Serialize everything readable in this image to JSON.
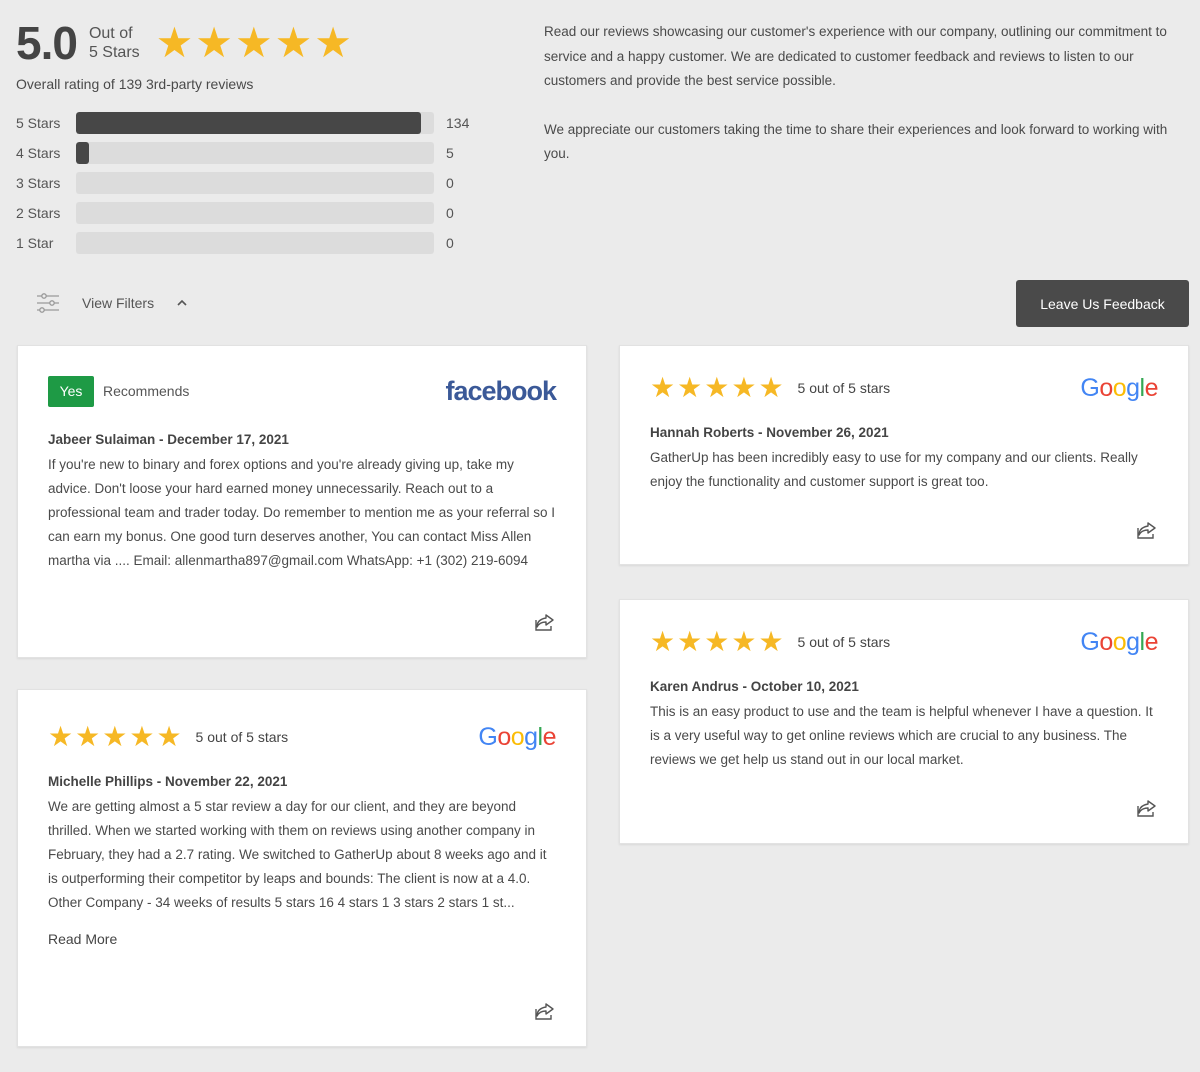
{
  "summary": {
    "rating": "5.0",
    "out_of_line1": "Out of",
    "out_of_line2": "5 Stars",
    "overall_text": "Overall rating of 139 3rd-party reviews",
    "distribution": [
      {
        "label": "5 Stars",
        "count": "134",
        "fraction": 0.964
      },
      {
        "label": "4 Stars",
        "count": "5",
        "fraction": 0.036
      },
      {
        "label": "3 Stars",
        "count": "0",
        "fraction": 0
      },
      {
        "label": "2 Stars",
        "count": "0",
        "fraction": 0
      },
      {
        "label": "1 Star",
        "count": "0",
        "fraction": 0
      }
    ]
  },
  "intro": {
    "p1": "Read our reviews showcasing our customer's experience with our company, outlining our commitment to service and a happy customer. We are dedicated to customer feedback and reviews to listen to our customers and provide the best service possible.",
    "p2": "We appreciate our customers taking the time to share their experiences and look forward to working with you."
  },
  "filters": {
    "label": "View Filters",
    "icon": "sliders-icon"
  },
  "feedback_button": "Leave Us Feedback",
  "reviews": [
    {
      "source": "facebook",
      "badge": "Yes",
      "recommends": "Recommends",
      "author": "Jabeer Sulaiman - December 17, 2021",
      "text": "If you're new to binary and forex options and you're already giving up, take my advice. Don't loose your hard earned money unnecessarily. Reach out to a professional team and trader today. Do remember to mention me as your referral so I can earn my bonus. One good turn deserves another, You can contact Miss Allen martha via .... Email: allenmartha897@gmail.com WhatsApp: +1 (302) 219-6094"
    },
    {
      "source": "Google",
      "stars_text": "5 out of 5 stars",
      "author": "Michelle Phillips - November 22, 2021",
      "text": "We are getting almost a 5 star review a day for our client, and they are beyond thrilled. When we started working with them on reviews using another company in February, they had a 2.7 rating. We switched to GatherUp about 8 weeks ago and it is outperforming their competitor by leaps and bounds: The client is now at a 4.0. Other Company - 34 weeks of results 5 stars 16 4 stars 1 3 stars 2 stars 1 st...",
      "read_more": "Read More"
    },
    {
      "source": "Google",
      "stars_text": "5 out of 5 stars",
      "author": "Hannah Roberts - November 26, 2021",
      "text": "GatherUp has been incredibly easy to use for my company and our clients. Really enjoy the functionality and customer support is great too."
    },
    {
      "source": "Google",
      "stars_text": "5 out of 5 stars",
      "author": "Karen Andrus - October 10, 2021",
      "text": "This is an easy product to use and the team is helpful whenever I have a question. It is a very useful way to get online reviews which are crucial to any business. The reviews we get help us stand out in our local market."
    }
  ],
  "colors": {
    "star": "#f6b825",
    "badge": "#1e9a45",
    "bar": "#474747",
    "button": "#4a4a4a"
  }
}
